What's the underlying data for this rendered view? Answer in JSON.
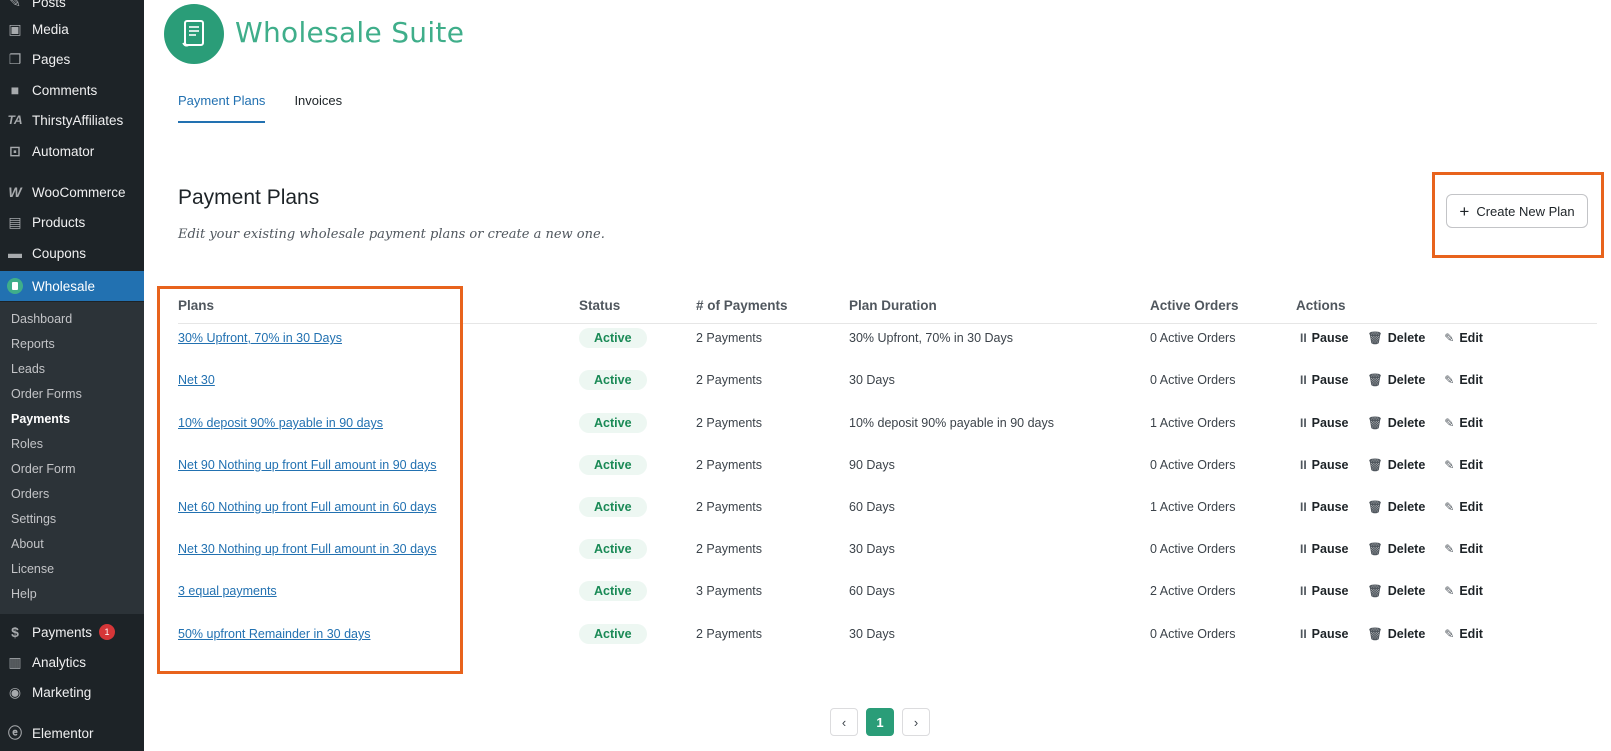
{
  "sidebar": {
    "items": [
      {
        "label": "Posts",
        "icon": "pushpin-icon"
      },
      {
        "label": "Media",
        "icon": "media-icon"
      },
      {
        "label": "Pages",
        "icon": "pages-icon"
      },
      {
        "label": "Comments",
        "icon": "comment-icon"
      },
      {
        "label": "ThirstyAffiliates",
        "icon": "ta-icon"
      },
      {
        "label": "Automator",
        "icon": "automator-icon"
      },
      {
        "label": "WooCommerce",
        "icon": "woo-icon"
      },
      {
        "label": "Products",
        "icon": "products-icon"
      },
      {
        "label": "Coupons",
        "icon": "coupons-icon"
      },
      {
        "label": "Wholesale",
        "icon": "wholesale-icon"
      }
    ],
    "submenu": [
      "Dashboard",
      "Reports",
      "Leads",
      "Order Forms",
      "Payments",
      "Roles",
      "Order Form",
      "Orders",
      "Settings",
      "About",
      "License",
      "Help"
    ],
    "bottom_items": [
      {
        "label": "Payments",
        "icon": "payments-icon",
        "badge": "1"
      },
      {
        "label": "Analytics",
        "icon": "analytics-icon"
      },
      {
        "label": "Marketing",
        "icon": "marketing-icon"
      },
      {
        "label": "Elementor",
        "icon": "elementor-icon"
      }
    ]
  },
  "header": {
    "brand": "Wholesale Suite"
  },
  "tabs": [
    {
      "label": "Payment Plans",
      "active": true
    },
    {
      "label": "Invoices",
      "active": false
    }
  ],
  "page": {
    "title": "Payment Plans",
    "description": "Edit your existing wholesale payment plans or create a new one.",
    "create_button": "Create New Plan"
  },
  "table": {
    "columns": [
      "Plans",
      "Status",
      "# of Payments",
      "Plan Duration",
      "Active Orders",
      "Actions"
    ],
    "rows": [
      {
        "plan": "30% Upfront, 70% in 30 Days",
        "status": "Active",
        "payments": "2 Payments",
        "duration": "30% Upfront, 70% in 30 Days",
        "orders": "0 Active Orders"
      },
      {
        "plan": "Net 30",
        "status": "Active",
        "payments": "2 Payments",
        "duration": "30 Days",
        "orders": "0 Active Orders"
      },
      {
        "plan": "10% deposit 90% payable in 90 days",
        "status": "Active",
        "payments": "2 Payments",
        "duration": "10% deposit 90% payable in 90 days",
        "orders": "1 Active Orders"
      },
      {
        "plan": "Net 90 Nothing up front Full amount in 90 days",
        "status": "Active",
        "payments": "2 Payments",
        "duration": "90 Days",
        "orders": "0 Active Orders"
      },
      {
        "plan": "Net 60 Nothing up front Full amount in 60 days",
        "status": "Active",
        "payments": "2 Payments",
        "duration": "60 Days",
        "orders": "1 Active Orders"
      },
      {
        "plan": "Net 30 Nothing up front Full amount in 30 days",
        "status": "Active",
        "payments": "2 Payments",
        "duration": "30 Days",
        "orders": "0 Active Orders"
      },
      {
        "plan": "3 equal payments",
        "status": "Active",
        "payments": "3 Payments",
        "duration": "60 Days",
        "orders": "2 Active Orders"
      },
      {
        "plan": "50% upfront Remainder in 30 days",
        "status": "Active",
        "payments": "2 Payments",
        "duration": "30 Days",
        "orders": "0 Active Orders"
      }
    ],
    "actions": {
      "pause": "Pause",
      "delete": "Delete",
      "edit": "Edit"
    }
  },
  "pagination": {
    "prev": "‹",
    "current": "1",
    "next": "›"
  },
  "colors": {
    "accent": "#2271b1",
    "brand": "#2a9d78",
    "highlight": "#e8631c",
    "sidebar_bg": "#1d2327"
  }
}
